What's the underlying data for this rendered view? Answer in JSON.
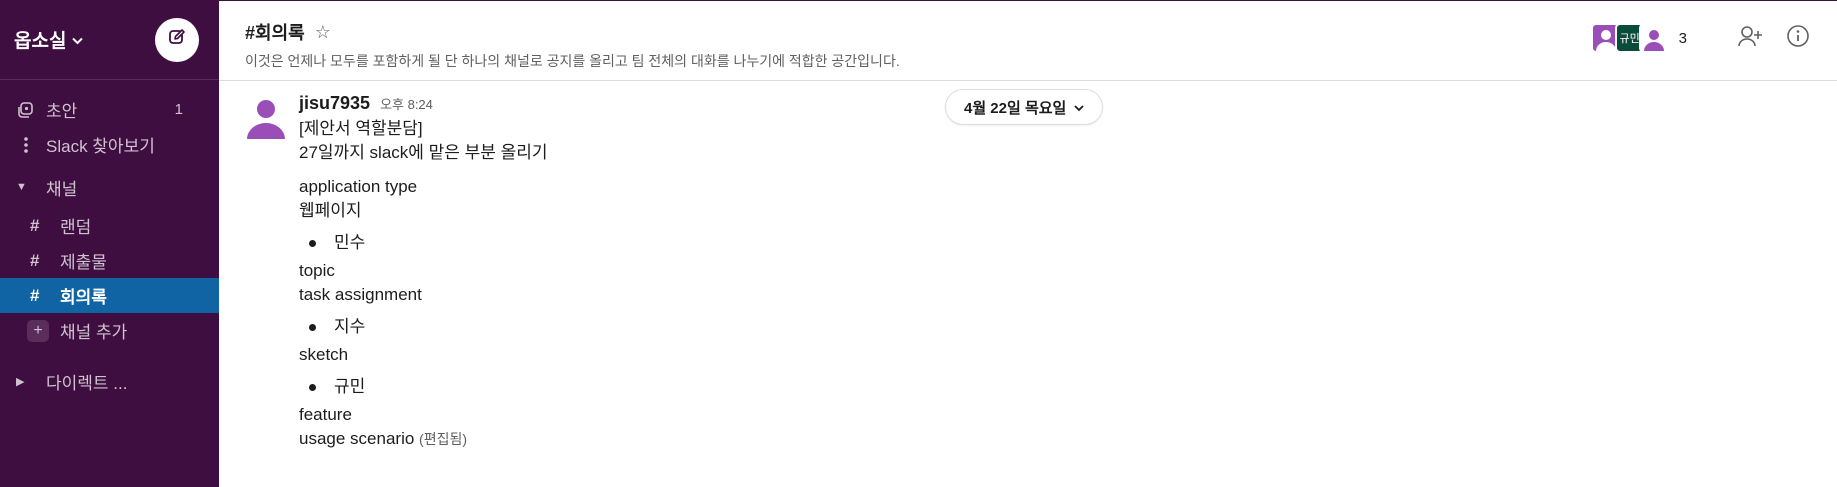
{
  "workspace": {
    "name": "옵소실",
    "chevron": "chevron-down-icon"
  },
  "sidebar": {
    "top_items": [
      {
        "label": "초안",
        "icon": "drafts-icon",
        "count": "1"
      },
      {
        "label": "Slack 찾아보기",
        "icon": "more-vertical-icon"
      }
    ],
    "channels_section": "채널",
    "channels": [
      {
        "label": "랜덤"
      },
      {
        "label": "제출물"
      },
      {
        "label": "회의록",
        "active": true
      }
    ],
    "add_channel": "채널 추가",
    "dm_section": "다이렉트 ..."
  },
  "channel": {
    "title": "#회의록",
    "topic": "이것은 언제나 모두를 포함하게 될 단 하나의 채널로 공지를 올리고 팀 전체의 대화를 나누기에 적합한 공간입니다.",
    "avatar_initials": "규민",
    "member_count": "3"
  },
  "date_divider": "4월 22일 목요일",
  "message": {
    "author": "jisu7935",
    "time": "오후 8:24",
    "lines_top": [
      "[제안서 역할분담]",
      "27일까지 slack에 맡은 부분 올리기"
    ],
    "app_type_label": "application type",
    "app_type_value": "웹페이지",
    "bullet1": "민수",
    "topic_label": "topic",
    "task_label": "task assignment",
    "bullet2": "지수",
    "sketch_label": "sketch",
    "bullet3": "규민",
    "feature_label": "feature",
    "usage_label": "usage scenario",
    "edited": "(편집됨)"
  },
  "colors": {
    "sidebar": "#3f0e40",
    "active": "#1164a3",
    "avatar_purple": "#9a4fb8"
  }
}
